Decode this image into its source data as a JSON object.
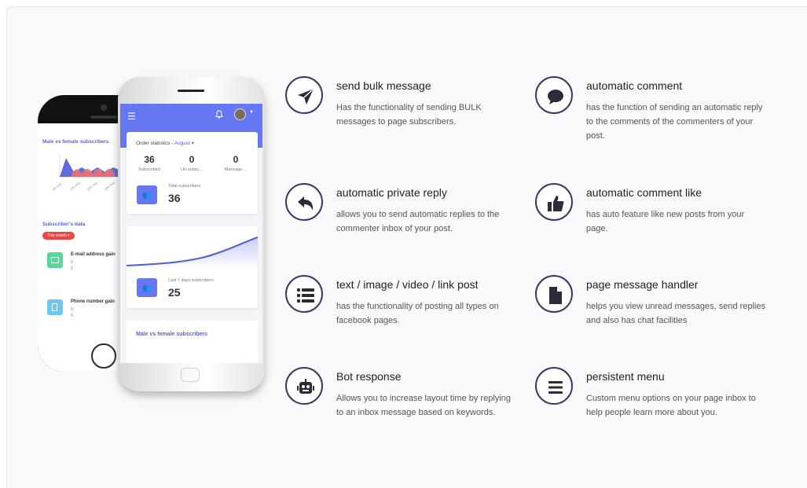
{
  "phone_back": {
    "chart_title": "Male vs female subscribers",
    "subscribers_data_title": "Subscriber's data",
    "month_pill": "This month ▾",
    "email_label": "E-mail address gain",
    "email_v1": "0",
    "email_v2": "0",
    "phone_label": "Phone number gain",
    "phone_v1": "0",
    "phone_v2": "0"
  },
  "phone_front": {
    "menu_icon": "☰",
    "bell_icon": "🔔",
    "order_stats_label": "Order statistics - ",
    "order_stats_month": "August ▾",
    "stats": [
      {
        "value": "36",
        "label": "Subscribed"
      },
      {
        "value": "0",
        "label": "Un-subsc..."
      },
      {
        "value": "0",
        "label": "Message ..."
      }
    ],
    "total_label": "Total subscribers",
    "total_value": "36",
    "last7_label": "Last 7 days subscribers",
    "last7_value": "25",
    "male_female_title": "Male vs female subscribers"
  },
  "features": [
    {
      "icon": "paper-plane-icon",
      "title": "send bulk message",
      "desc": "Has the functionality of sending BULK messages to page subscribers."
    },
    {
      "icon": "comment-icon",
      "title": "automatic comment",
      "desc": "has the function of sending an automatic reply to the comments of the commenters of your post."
    },
    {
      "icon": "reply-icon",
      "title": "automatic private reply",
      "desc": "allows you to send automatic replies to the commenter inbox of your post."
    },
    {
      "icon": "thumbs-up-icon",
      "title": "automatic comment like",
      "desc": "has auto feature like new posts from your page."
    },
    {
      "icon": "list-icon",
      "title": "text / image / video / link post",
      "desc": "has the functionality of posting all types on facebook pages."
    },
    {
      "icon": "file-icon",
      "title": "page message handler",
      "desc": "helps you view unread messages, send replies and also has chat facilities"
    },
    {
      "icon": "robot-icon",
      "title": "Bot response",
      "desc": "Allows you to increase layout time by replying to an inbox message based on keywords."
    },
    {
      "icon": "menu-bars-icon",
      "title": "persistent menu",
      "desc": "Custom menu options on your page inbox to help people learn more about you."
    }
  ],
  "colors": {
    "accent": "#6577f2",
    "icon_border": "#3a3566",
    "icon_fill": "#2b2b3a"
  }
}
